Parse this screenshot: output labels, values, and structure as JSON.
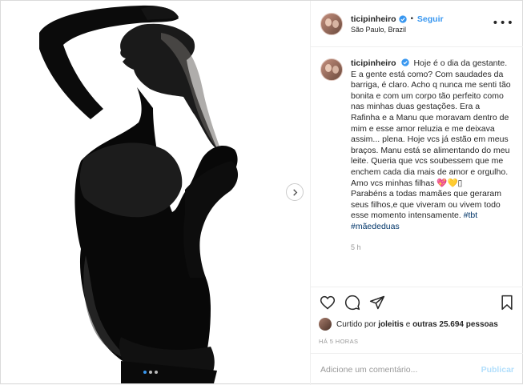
{
  "post": {
    "username": "ticipinheiro",
    "follow_label": "Seguir",
    "separator": "•",
    "location": "São Paulo, Brazil",
    "more_label": "•••"
  },
  "caption": {
    "username": "ticipinheiro",
    "text": "Hoje é o dia da gestante. E a gente está como? Com saudades da barriga, é claro. Acho q nunca me senti tão bonita e com um corpo tão perfeito como nas minhas duas gestações. Era a Rafinha e a Manu que moravam dentro de mim e esse amor reluzia e me deixava assim... plena. Hoje vcs já estão em meus braços. Manu está se alimentando do meu leite. Queria que vcs soubessem que me enchem cada dia mais de amor e orgulho. Amo vcs minhas filhas 💖💛▯",
    "text2": "Parabéns a todas mamães que geraram seus filhos,e que viveram ou vivem todo esse momento intensamente.",
    "hashtag1": "#tbt",
    "hashtag2": "#mãededuas",
    "time": "5 h"
  },
  "likes": {
    "prefix": "Curtido por",
    "user": "joleitis",
    "middle": "e",
    "others": "outras 25.694 pessoas"
  },
  "posted_ago": "HÁ 5 HORAS",
  "comment": {
    "placeholder": "Adicione um comentário...",
    "publish_label": "Publicar"
  },
  "carousel": {
    "slides": 3,
    "active_index": 0
  },
  "colors": {
    "accent": "#3897f0",
    "hashtag": "#003569",
    "muted": "#999999",
    "publish_disabled": "#b2dffc"
  },
  "icons": [
    "verified-badge-icon",
    "heart-icon",
    "comment-icon",
    "share-icon",
    "bookmark-icon",
    "chevron-right-icon"
  ]
}
